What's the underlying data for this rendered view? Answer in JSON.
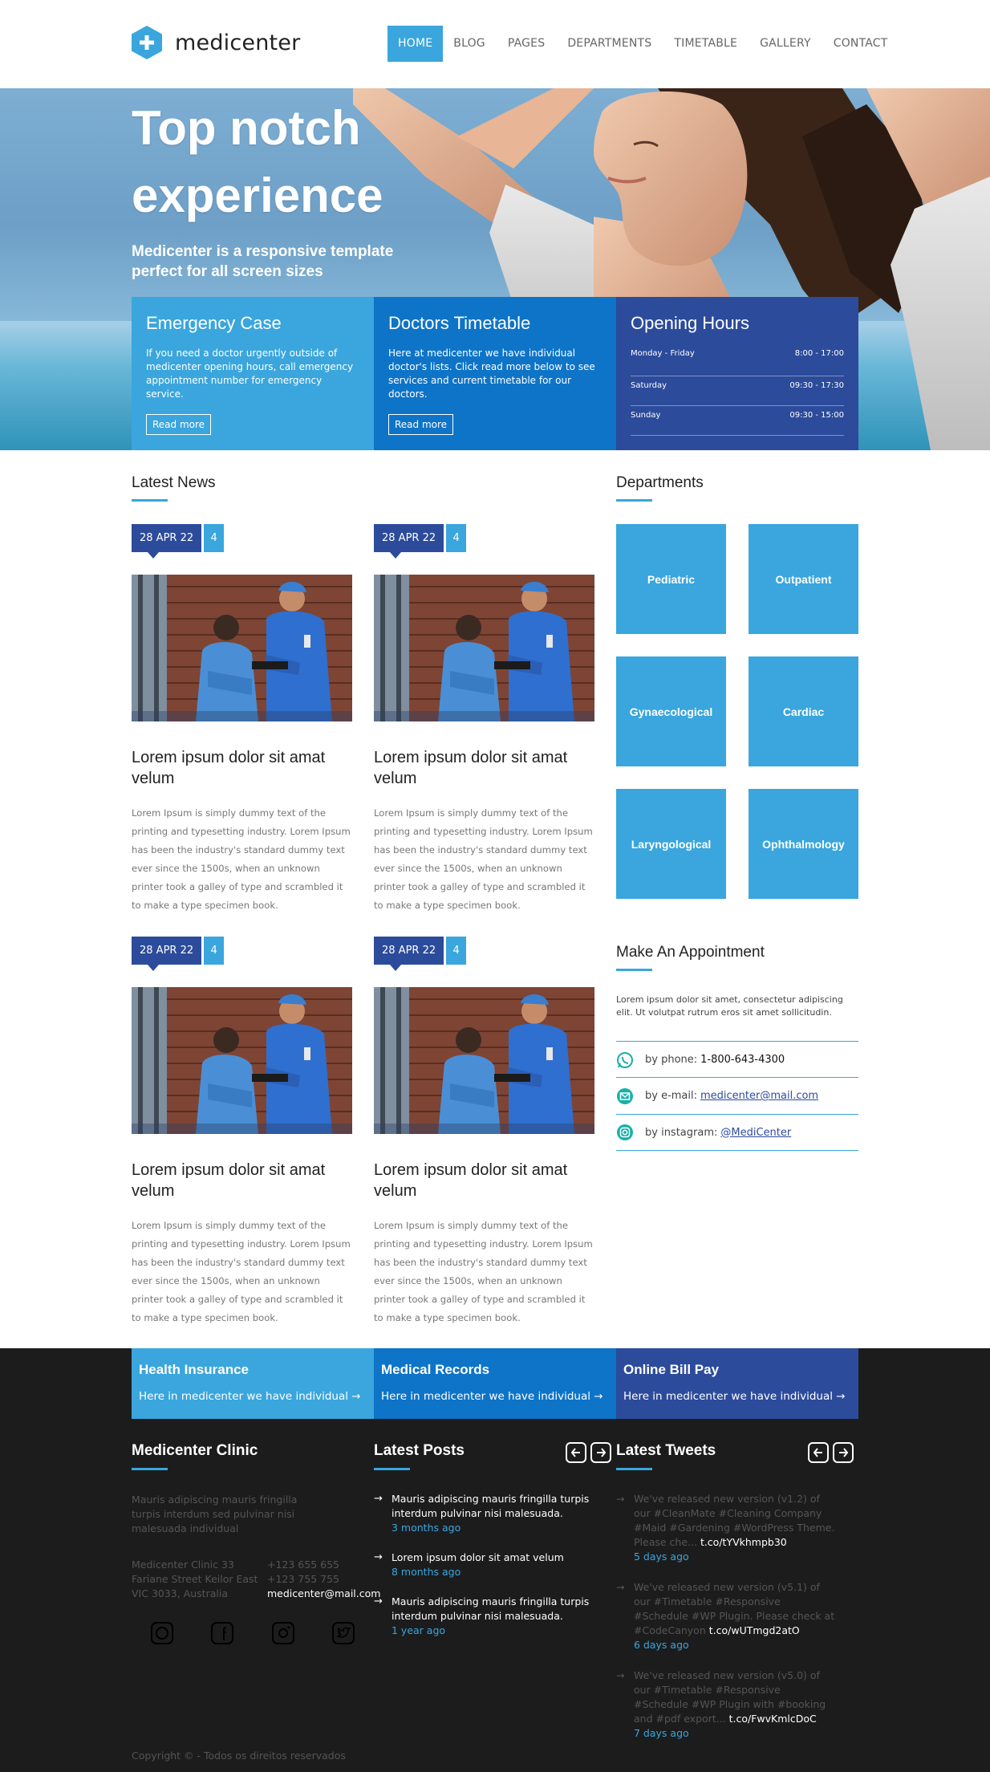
{
  "header": {
    "logo_text": "medicenter",
    "nav": [
      "HOME",
      "BLOG",
      "PAGES",
      "DEPARTMENTS",
      "TIMETABLE",
      "GALLERY",
      "CONTACT"
    ]
  },
  "hero": {
    "title": "Top notch experience",
    "subtitle": "Medicenter is a responsive template perfect for all screen sizes"
  },
  "boxes": [
    {
      "title": "Emergency Case",
      "text": "If you need a doctor urgently outside of medicenter opening hours, call emergency appointment number for emergency service.",
      "button": "Read more"
    },
    {
      "title": "Doctors Timetable",
      "text": "Here at medicenter we have individual doctor's lists. Click read more below to see services and current timetable for our doctors.",
      "button": "Read more"
    }
  ],
  "opening_hours": {
    "title": "Opening Hours",
    "rows": [
      {
        "day": "Monday - Friday",
        "time": "8:00 - 17:00"
      },
      {
        "day": "Saturday",
        "time": "09:30 - 17:30"
      },
      {
        "day": "Sunday",
        "time": "09:30 - 15:00"
      }
    ]
  },
  "latest_news": {
    "title": "Latest News",
    "items": [
      {
        "date": "28 APR 22",
        "count": "4",
        "title": "Lorem ipsum dolor sit amat velum",
        "text": "Lorem Ipsum is simply dummy text of the printing and typesetting industry. Lorem Ipsum has been the industry's standard dummy text ever since the 1500s, when an unknown printer took a galley of type and scrambled it to make a type specimen book."
      },
      {
        "date": "28 APR 22",
        "count": "4",
        "title": "Lorem ipsum dolor sit amat velum",
        "text": "Lorem Ipsum is simply dummy text of the printing and typesetting industry. Lorem Ipsum has been the industry's standard dummy text ever since the 1500s, when an unknown printer took a galley of type and scrambled it to make a type specimen book."
      },
      {
        "date": "28 APR 22",
        "count": "4",
        "title": "Lorem ipsum dolor sit amat velum",
        "text": "Lorem Ipsum is simply dummy text of the printing and typesetting industry. Lorem Ipsum has been the industry's standard dummy text ever since the 1500s, when an unknown printer took a galley of type and scrambled it to make a type specimen book."
      },
      {
        "date": "28 APR 22",
        "count": "4",
        "title": "Lorem ipsum dolor sit amat velum",
        "text": "Lorem Ipsum is simply dummy text of the printing and typesetting industry. Lorem Ipsum has been the industry's standard dummy text ever since the 1500s, when an unknown printer took a galley of type and scrambled it to make a type specimen book."
      }
    ]
  },
  "departments": {
    "title": "Departments",
    "items": [
      "Pediatric",
      "Outpatient",
      "Gynaecological",
      "Cardiac",
      "Laryngological",
      "Ophthalmology"
    ]
  },
  "appointment": {
    "title": "Make An Appointment",
    "text": "Lorem ipsum dolor sit amet, consectetur adipiscing elit. Ut volutpat rutrum eros sit amet sollicitudin.",
    "phone_label": "by phone:",
    "phone": "1-800-643-4300",
    "email_label": "by e-mail:",
    "email": "medicenter@mail.com",
    "instagram_label": "by instagram:",
    "instagram": "@MediCenter"
  },
  "footer_boxes": [
    {
      "title": "Health Insurance",
      "text": "Here in medicenter we have individual →"
    },
    {
      "title": "Medical Records",
      "text": "Here in medicenter we have individual →"
    },
    {
      "title": "Online Bill Pay",
      "text": "Here in medicenter we have individual →"
    }
  ],
  "clinic": {
    "title": "Medicenter Clinic",
    "text": "Mauris adipiscing mauris fringilla turpis interdum sed pulvinar nisi malesuada individual",
    "address": [
      "Medicenter Clinic 33",
      "Fariane Street Keilor East",
      "VIC 3033, Australia"
    ],
    "phones": [
      "+123 655 655",
      "+123 755 755"
    ],
    "email": "medicenter@mail.com"
  },
  "latest_posts": {
    "title": "Latest Posts",
    "items": [
      {
        "text": "Mauris adipiscing mauris fringilla turpis interdum pulvinar nisi malesuada.",
        "time": "3 months ago"
      },
      {
        "text": "Lorem ipsum dolor sit amat velum",
        "time": "8 months ago"
      },
      {
        "text": "Mauris adipiscing mauris fringilla turpis interdum pulvinar nisi malesuada.",
        "time": "1 year ago"
      }
    ]
  },
  "latest_tweets": {
    "title": "Latest Tweets",
    "items": [
      {
        "text": "We've released new version (v1.2) of our #CleanMate #Cleaning Company #Maid #Gardening #WordPress Theme. Please che...",
        "link": "t.co/tYVkhmpb30",
        "time": "5 days ago"
      },
      {
        "text": "We've released new version (v5.1) of our #Timetable #Responsive #Schedule #WP Plugin. Please check at #CodeCanyon",
        "link": "t.co/wUTmgd2atO",
        "time": "6 days ago"
      },
      {
        "text": "We've released new version (v5.0) of our #Timetable #Responsive #Schedule #WP Plugin with #booking and #pdf export...",
        "link": "t.co/FwvKmlcDoC",
        "time": "7 days ago"
      }
    ]
  },
  "copyright": "Copyright © - Todos os direitos reservados",
  "colors": {
    "accent": "#3aa6dd",
    "mid_blue": "#0e74c8",
    "navy": "#2c4b9b",
    "footer_bg": "#1c1c1d",
    "teal_icon": "#19b0a8"
  }
}
